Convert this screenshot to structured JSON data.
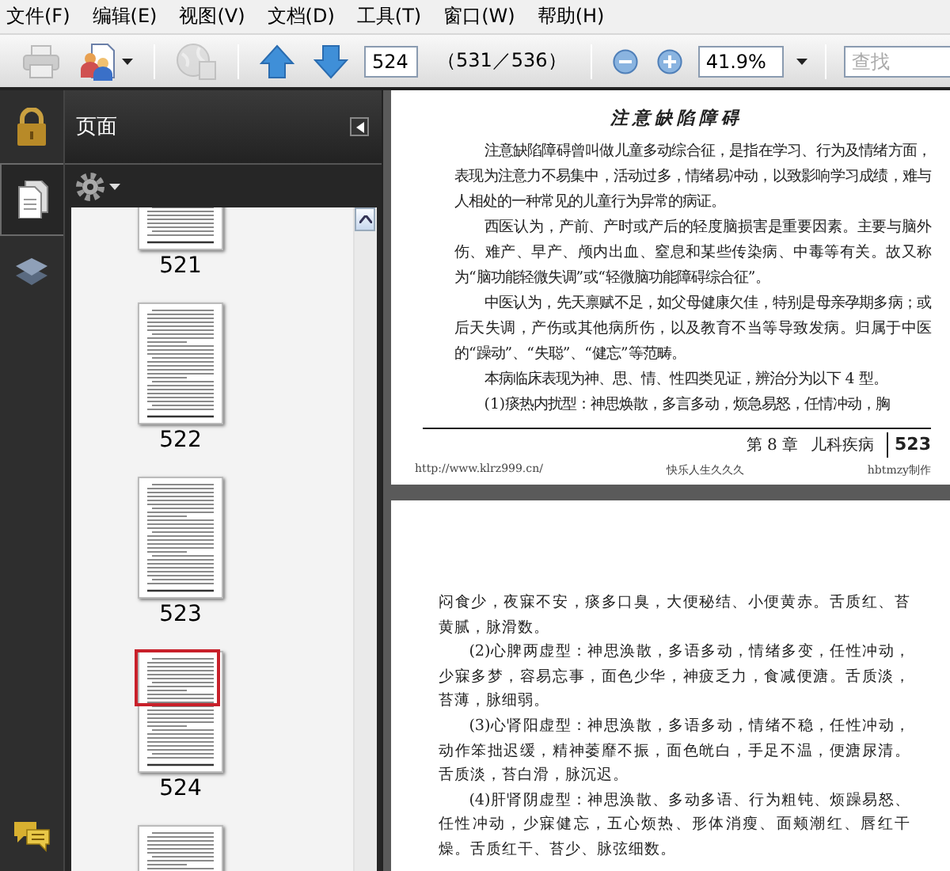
{
  "menu": [
    "文件(F)",
    "编辑(E)",
    "视图(V)",
    "文档(D)",
    "工具(T)",
    "窗口(W)",
    "帮助(H)"
  ],
  "toolbar": {
    "items": [
      {
        "kind": "print",
        "disabled": true
      },
      {
        "kind": "share",
        "disabled": false
      },
      {
        "kind": "separator"
      },
      {
        "kind": "web",
        "disabled": true
      },
      {
        "kind": "separator"
      },
      {
        "kind": "prev",
        "disabled": false
      },
      {
        "kind": "next",
        "disabled": false
      },
      {
        "kind": "page_field",
        "value": "524"
      },
      {
        "kind": "page_count",
        "text": "（531／536）"
      },
      {
        "kind": "separator"
      },
      {
        "kind": "zoom_out",
        "disabled": false
      },
      {
        "kind": "zoom_in",
        "disabled": false
      },
      {
        "kind": "zoom_field",
        "value": "41.9%"
      },
      {
        "kind": "separator"
      },
      {
        "kind": "search_field",
        "placeholder": "查找"
      }
    ]
  },
  "sidebar": {
    "tabs": [
      {
        "kind": "lock",
        "selected": false
      },
      {
        "kind": "pages",
        "selected": true
      },
      {
        "kind": "layers",
        "selected": false
      },
      {
        "kind": "comments",
        "selected": false
      }
    ],
    "panel_title": "页面",
    "thumbnails": [
      {
        "label": "521",
        "current": false
      },
      {
        "label": "522",
        "current": false
      },
      {
        "label": "523",
        "current": false
      },
      {
        "label": "524",
        "current": true
      },
      {
        "current": false
      }
    ]
  },
  "pages": [
    {
      "title": "注意缺陷障碍",
      "paragraphs": [
        {
          "indent": true,
          "text": "注意缺陷障碍曾叫做儿童多动综合征，是指在学习、行为及情绪方面，表现为注意力不易集中，活动过多，情绪易冲动，以致影响学习成绩，难与人相处的一种常见的儿童行为异常的病证。"
        },
        {
          "indent": true,
          "text": "西医认为，产前、产时或产后的轻度脑损害是重要因素。主要与脑外伤、难产、早产、颅内出血、窒息和某些传染病、中毒等有关。故又称为“脑功能轻微失调”或“轻微脑功能障碍综合征”。"
        },
        {
          "indent": true,
          "text": "中医认为，先天禀赋不足，如父母健康欠佳，特别是母亲孕期多病；或后天失调，产伤或其他病所伤，以及教育不当等导致发病。归属于中医的“躁动”、“失聪”、“健忘”等范畴。"
        },
        {
          "indent": true,
          "text": "本病临床表现为神、思、情、性四类见证，辨治分为以下 4 型。"
        },
        {
          "indent": true,
          "text": "(1)痰热内扰型：神思焕散，多言多动，烦急易怒，任情冲动，胸"
        }
      ],
      "footer": {
        "chapter": "第 8 章",
        "chapter_title": "儿科疾病",
        "page_number": "523",
        "url": "http://www.klrz999.cn/",
        "slogan": "快乐人生久久久",
        "credit": "hbtmzy制作"
      }
    },
    {
      "paragraphs": [
        {
          "indent": false,
          "text": "闷食少，夜寐不安，痰多口臭，大便秘结、小便黄赤。舌质红、苔黄腻，脉滑数。"
        },
        {
          "indent": true,
          "text": "(2)心脾两虚型：神思涣散，多语多动，情绪多变，任性冲动，少寐多梦，容易忘事，面色少华，神疲乏力，食减便溏。舌质淡，苔薄，脉细弱。"
        },
        {
          "indent": true,
          "text": "(3)心肾阳虚型：神思涣散，多语多动，情绪不稳，任性冲动，动作笨拙迟缓，精神萎靡不振，面色㿠白，手足不温，便溏尿清。舌质淡，苔白滑，脉沉迟。"
        },
        {
          "indent": true,
          "text": "(4)肝肾阴虚型：神思涣散、多动多语、行为粗钝、烦躁易怒、任性冲动，少寐健忘，五心烦热、形体消瘦、面颊潮红、唇红干燥。舌质红干、苔少、脉弦细数。"
        }
      ]
    }
  ]
}
